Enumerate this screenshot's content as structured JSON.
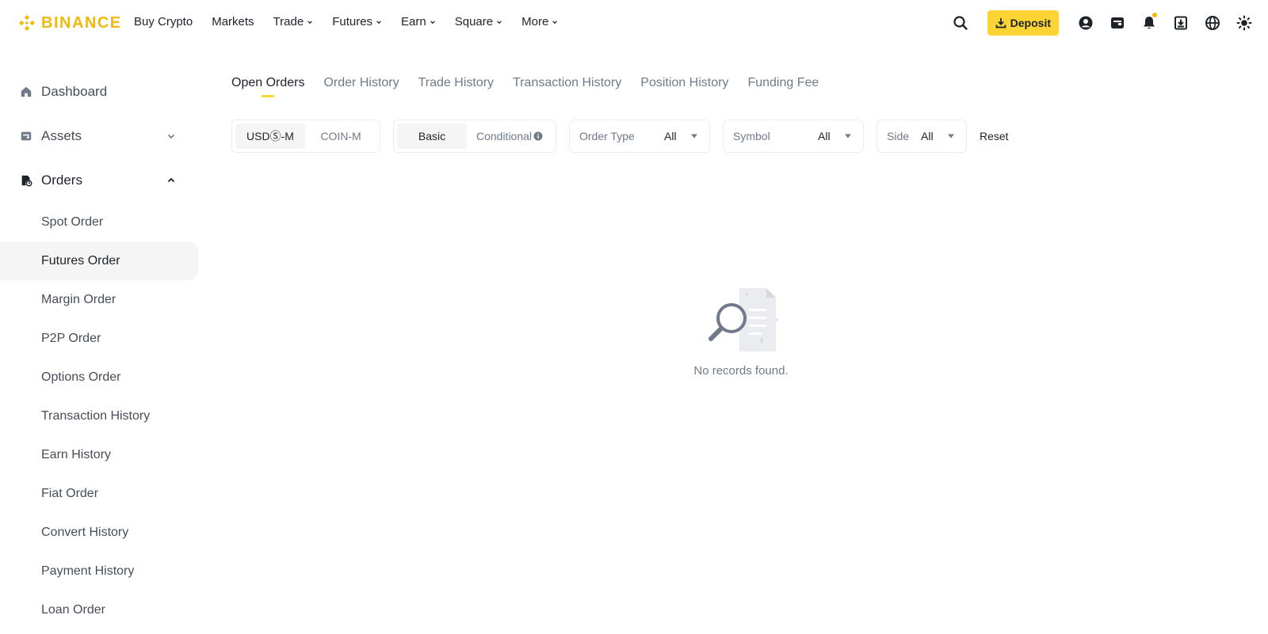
{
  "brand": {
    "name": "BINANCE",
    "color": "#f0b90b"
  },
  "nav": [
    {
      "label": "Buy Crypto",
      "dropdown": false
    },
    {
      "label": "Markets",
      "dropdown": false
    },
    {
      "label": "Trade",
      "dropdown": true
    },
    {
      "label": "Futures",
      "dropdown": true
    },
    {
      "label": "Earn",
      "dropdown": true
    },
    {
      "label": "Square",
      "dropdown": true
    },
    {
      "label": "More",
      "dropdown": true
    }
  ],
  "header": {
    "deposit_label": "Deposit",
    "icons": [
      "search-icon",
      "user-icon",
      "wallet-icon",
      "bell-icon",
      "download-app-icon",
      "globe-icon",
      "theme-icon"
    ]
  },
  "sidebar": {
    "top_items": [
      {
        "label": "Dashboard",
        "icon": "home-icon"
      },
      {
        "label": "Assets",
        "icon": "wallet-icon",
        "expanded": false
      },
      {
        "label": "Orders",
        "icon": "orders-icon",
        "expanded": true
      }
    ],
    "order_items": [
      "Spot Order",
      "Futures Order",
      "Margin Order",
      "P2P Order",
      "Options Order",
      "Transaction History",
      "Earn History",
      "Fiat Order",
      "Convert History",
      "Payment History",
      "Loan Order"
    ],
    "selected": "Futures Order"
  },
  "tabs": [
    {
      "label": "Open Orders",
      "active": true
    },
    {
      "label": "Order History",
      "active": false
    },
    {
      "label": "Trade History",
      "active": false
    },
    {
      "label": "Transaction History",
      "active": false
    },
    {
      "label": "Position History",
      "active": false
    },
    {
      "label": "Funding Fee",
      "active": false
    }
  ],
  "filters": {
    "margin_type": {
      "options": [
        "USDⓈ-M",
        "COIN-M"
      ],
      "selected": "USDⓈ-M"
    },
    "order_mode": {
      "options": [
        "Basic",
        "Conditional"
      ],
      "selected": "Basic"
    },
    "order_type": {
      "label": "Order Type",
      "value": "All"
    },
    "symbol": {
      "label": "Symbol",
      "value": "All"
    },
    "side": {
      "label": "Side",
      "value": "All"
    },
    "reset_label": "Reset"
  },
  "empty_state": {
    "message": "No records found."
  },
  "colors": {
    "accent": "#fcd535",
    "text": "#1e2329",
    "muted": "#707a8a",
    "border": "#eaecef",
    "selected_bg": "#f5f5f5"
  }
}
